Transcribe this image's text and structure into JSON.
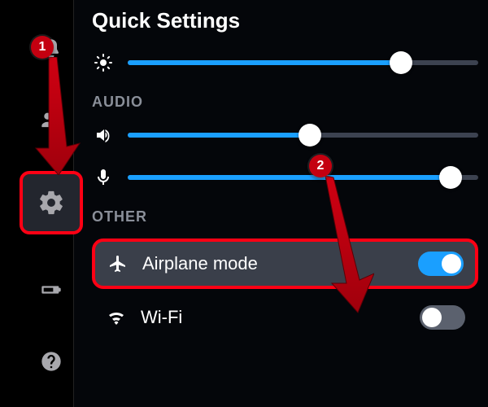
{
  "title": "Quick Settings",
  "brightness": {
    "value": 78
  },
  "sections": {
    "audio": {
      "header": "AUDIO",
      "volume": {
        "value": 52
      },
      "mic": {
        "value": 92
      }
    },
    "other": {
      "header": "OTHER",
      "airplane": {
        "label": "Airplane mode",
        "on": true
      },
      "wifi": {
        "label": "Wi-Fi",
        "on": false
      }
    }
  },
  "sidebar": {
    "items": [
      {
        "name": "notifications"
      },
      {
        "name": "friends"
      },
      {
        "name": "settings"
      },
      {
        "name": "battery"
      },
      {
        "name": "help"
      }
    ]
  },
  "annotations": {
    "badge1": "1",
    "badge2": "2"
  }
}
